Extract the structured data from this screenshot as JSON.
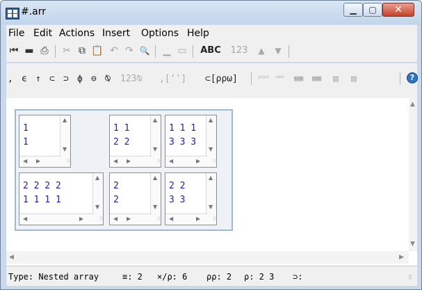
{
  "window": {
    "title": "#.arr",
    "min_glyph": "▁",
    "max_glyph": "▢",
    "close_glyph": "✕"
  },
  "menu": [
    "File",
    "Edit",
    "Actions",
    "Insert",
    "Options",
    "Help"
  ],
  "toolbar1": {
    "first_icon": "⏮",
    "save_icon": "▬",
    "print_icon": "⎙",
    "cut_icon": "✂",
    "copy_icon": "⧉",
    "paste_icon": "📋",
    "undo_icon": "↶",
    "redo_icon": "↷",
    "find_icon": "🔍",
    "line_icon": "▁",
    "box_icon": "▭",
    "abc_label": "ABC",
    "num_label": "123",
    "up_icon": "▲",
    "down_icon": "▼"
  },
  "toolbar2": {
    "symbols": [
      ",",
      "ϵ",
      "↑",
      "⊂",
      "⊃",
      "ϕ",
      "⊖",
      "⍉"
    ],
    "format_label": "123⍉",
    "quote_label": ",['']",
    "enclose_label": "⊂[ρρω]",
    "layout_icons": [
      "▫▫▫",
      "▭▭",
      "▦▦",
      "▦▦",
      "▤",
      "▤"
    ],
    "help_glyph": "?"
  },
  "grid": {
    "cells": [
      {
        "rows": [
          "1",
          "1"
        ]
      },
      {
        "rows": [
          "1 1",
          "2 2"
        ]
      },
      {
        "rows": [
          "1 1 1",
          "3 3 3"
        ]
      },
      {
        "rows": [
          "2 2 2 2",
          "1 1 1 1"
        ]
      },
      {
        "rows": [
          "2",
          "2"
        ]
      },
      {
        "rows": [
          "2 2",
          "3 3"
        ]
      }
    ]
  },
  "status": {
    "type": "Type: Nested array",
    "depth": "≡: 2",
    "count": "×/ρ: 6",
    "rank": "ρρ: 2",
    "shape": "ρ: 2 3",
    "first": "⊃:"
  },
  "colors": {
    "accent": "#1c1ccc",
    "titlebar": "#c9d8ea",
    "close": "#c6422c"
  }
}
